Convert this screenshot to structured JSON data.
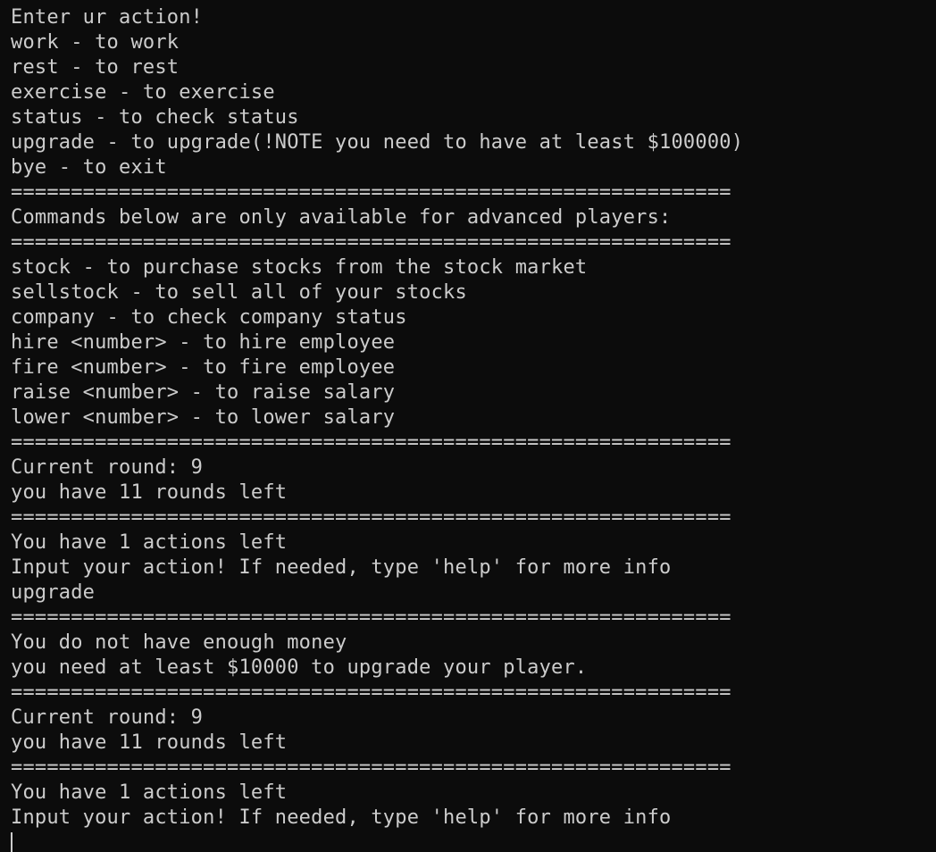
{
  "terminal": {
    "lines": [
      "Enter ur action!",
      "work - to work",
      "rest - to rest",
      "exercise - to exercise",
      "status - to check status",
      "upgrade - to upgrade(!NOTE you need to have at least $100000)",
      "bye - to exit",
      "============================================================",
      "Commands below are only available for advanced players:",
      "============================================================",
      "stock - to purchase stocks from the stock market",
      "sellstock - to sell all of your stocks",
      "company - to check company status",
      "hire <number> - to hire employee",
      "fire <number> - to fire employee",
      "raise <number> - to raise salary",
      "lower <number> - to lower salary",
      "============================================================",
      "Current round: 9",
      "you have 11 rounds left",
      "============================================================",
      "You have 1 actions left",
      "Input your action! If needed, type 'help' for more info",
      "upgrade",
      "============================================================",
      "You do not have enough money",
      "you need at least $10000 to upgrade your player.",
      "============================================================",
      "Current round: 9",
      "you have 11 rounds left",
      "============================================================",
      "You have 1 actions left",
      "Input your action! If needed, type 'help' for more info"
    ]
  },
  "colors": {
    "background": "#0c0c0c",
    "foreground": "#cccccc"
  }
}
